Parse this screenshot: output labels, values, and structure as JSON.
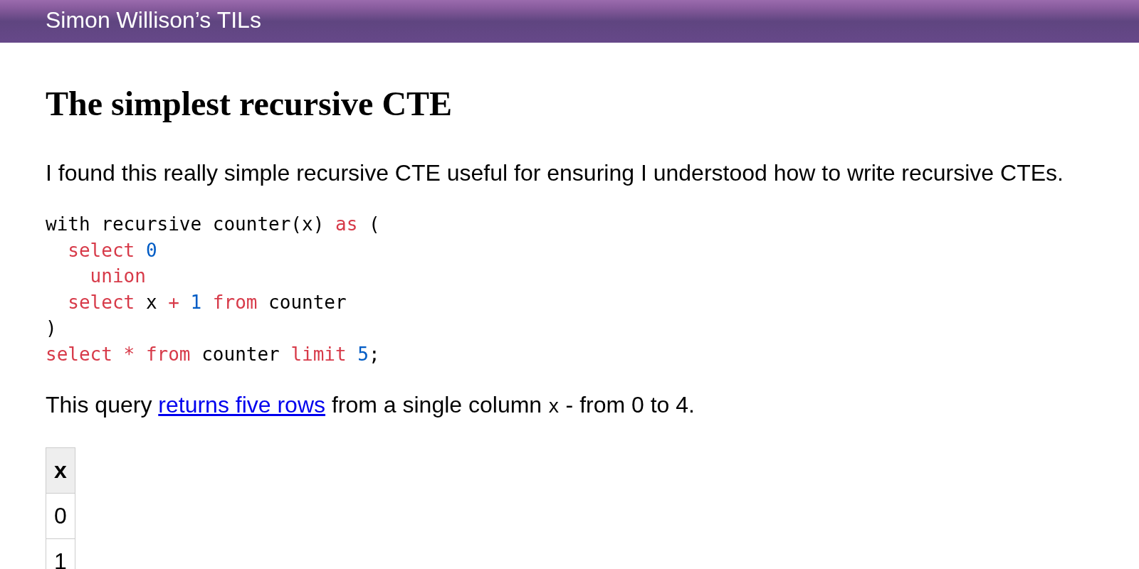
{
  "header": {
    "title": "Simon Willison’s TILs"
  },
  "article": {
    "title": "The simplest recursive CTE",
    "intro": "I found this really simple recursive CTE useful for ensuring I understood how to write recursive CTEs.",
    "code": {
      "lines": [
        [
          {
            "kind": "plain",
            "text": "with recursive counter(x) "
          },
          {
            "kind": "keyword",
            "text": "as"
          },
          {
            "kind": "plain",
            "text": " ("
          }
        ],
        [
          {
            "kind": "keyword",
            "text": "  select"
          },
          {
            "kind": "number",
            "text": " 0"
          }
        ],
        [
          {
            "kind": "keyword",
            "text": "    union"
          }
        ],
        [
          {
            "kind": "keyword",
            "text": "  select"
          },
          {
            "kind": "plain",
            "text": " x "
          },
          {
            "kind": "operator",
            "text": "+"
          },
          {
            "kind": "number",
            "text": " 1"
          },
          {
            "kind": "keyword",
            "text": " from"
          },
          {
            "kind": "plain",
            "text": " counter"
          }
        ],
        [
          {
            "kind": "plain",
            "text": ")"
          }
        ],
        [
          {
            "kind": "keyword",
            "text": "select"
          },
          {
            "kind": "operator",
            "text": " *"
          },
          {
            "kind": "keyword",
            "text": " from"
          },
          {
            "kind": "plain",
            "text": " counter "
          },
          {
            "kind": "keyword",
            "text": "limit"
          },
          {
            "kind": "number",
            "text": " 5"
          },
          {
            "kind": "plain",
            "text": ";"
          }
        ]
      ]
    },
    "result_text": [
      {
        "kind": "text",
        "text": "This query "
      },
      {
        "kind": "link",
        "text": "returns five rows"
      },
      {
        "kind": "text",
        "text": " from a single column "
      },
      {
        "kind": "code",
        "text": "x"
      },
      {
        "kind": "text",
        "text": " - from 0 to 4."
      }
    ],
    "table": {
      "columns": [
        "x"
      ],
      "rows": [
        [
          "0"
        ],
        [
          "1"
        ]
      ]
    }
  }
}
